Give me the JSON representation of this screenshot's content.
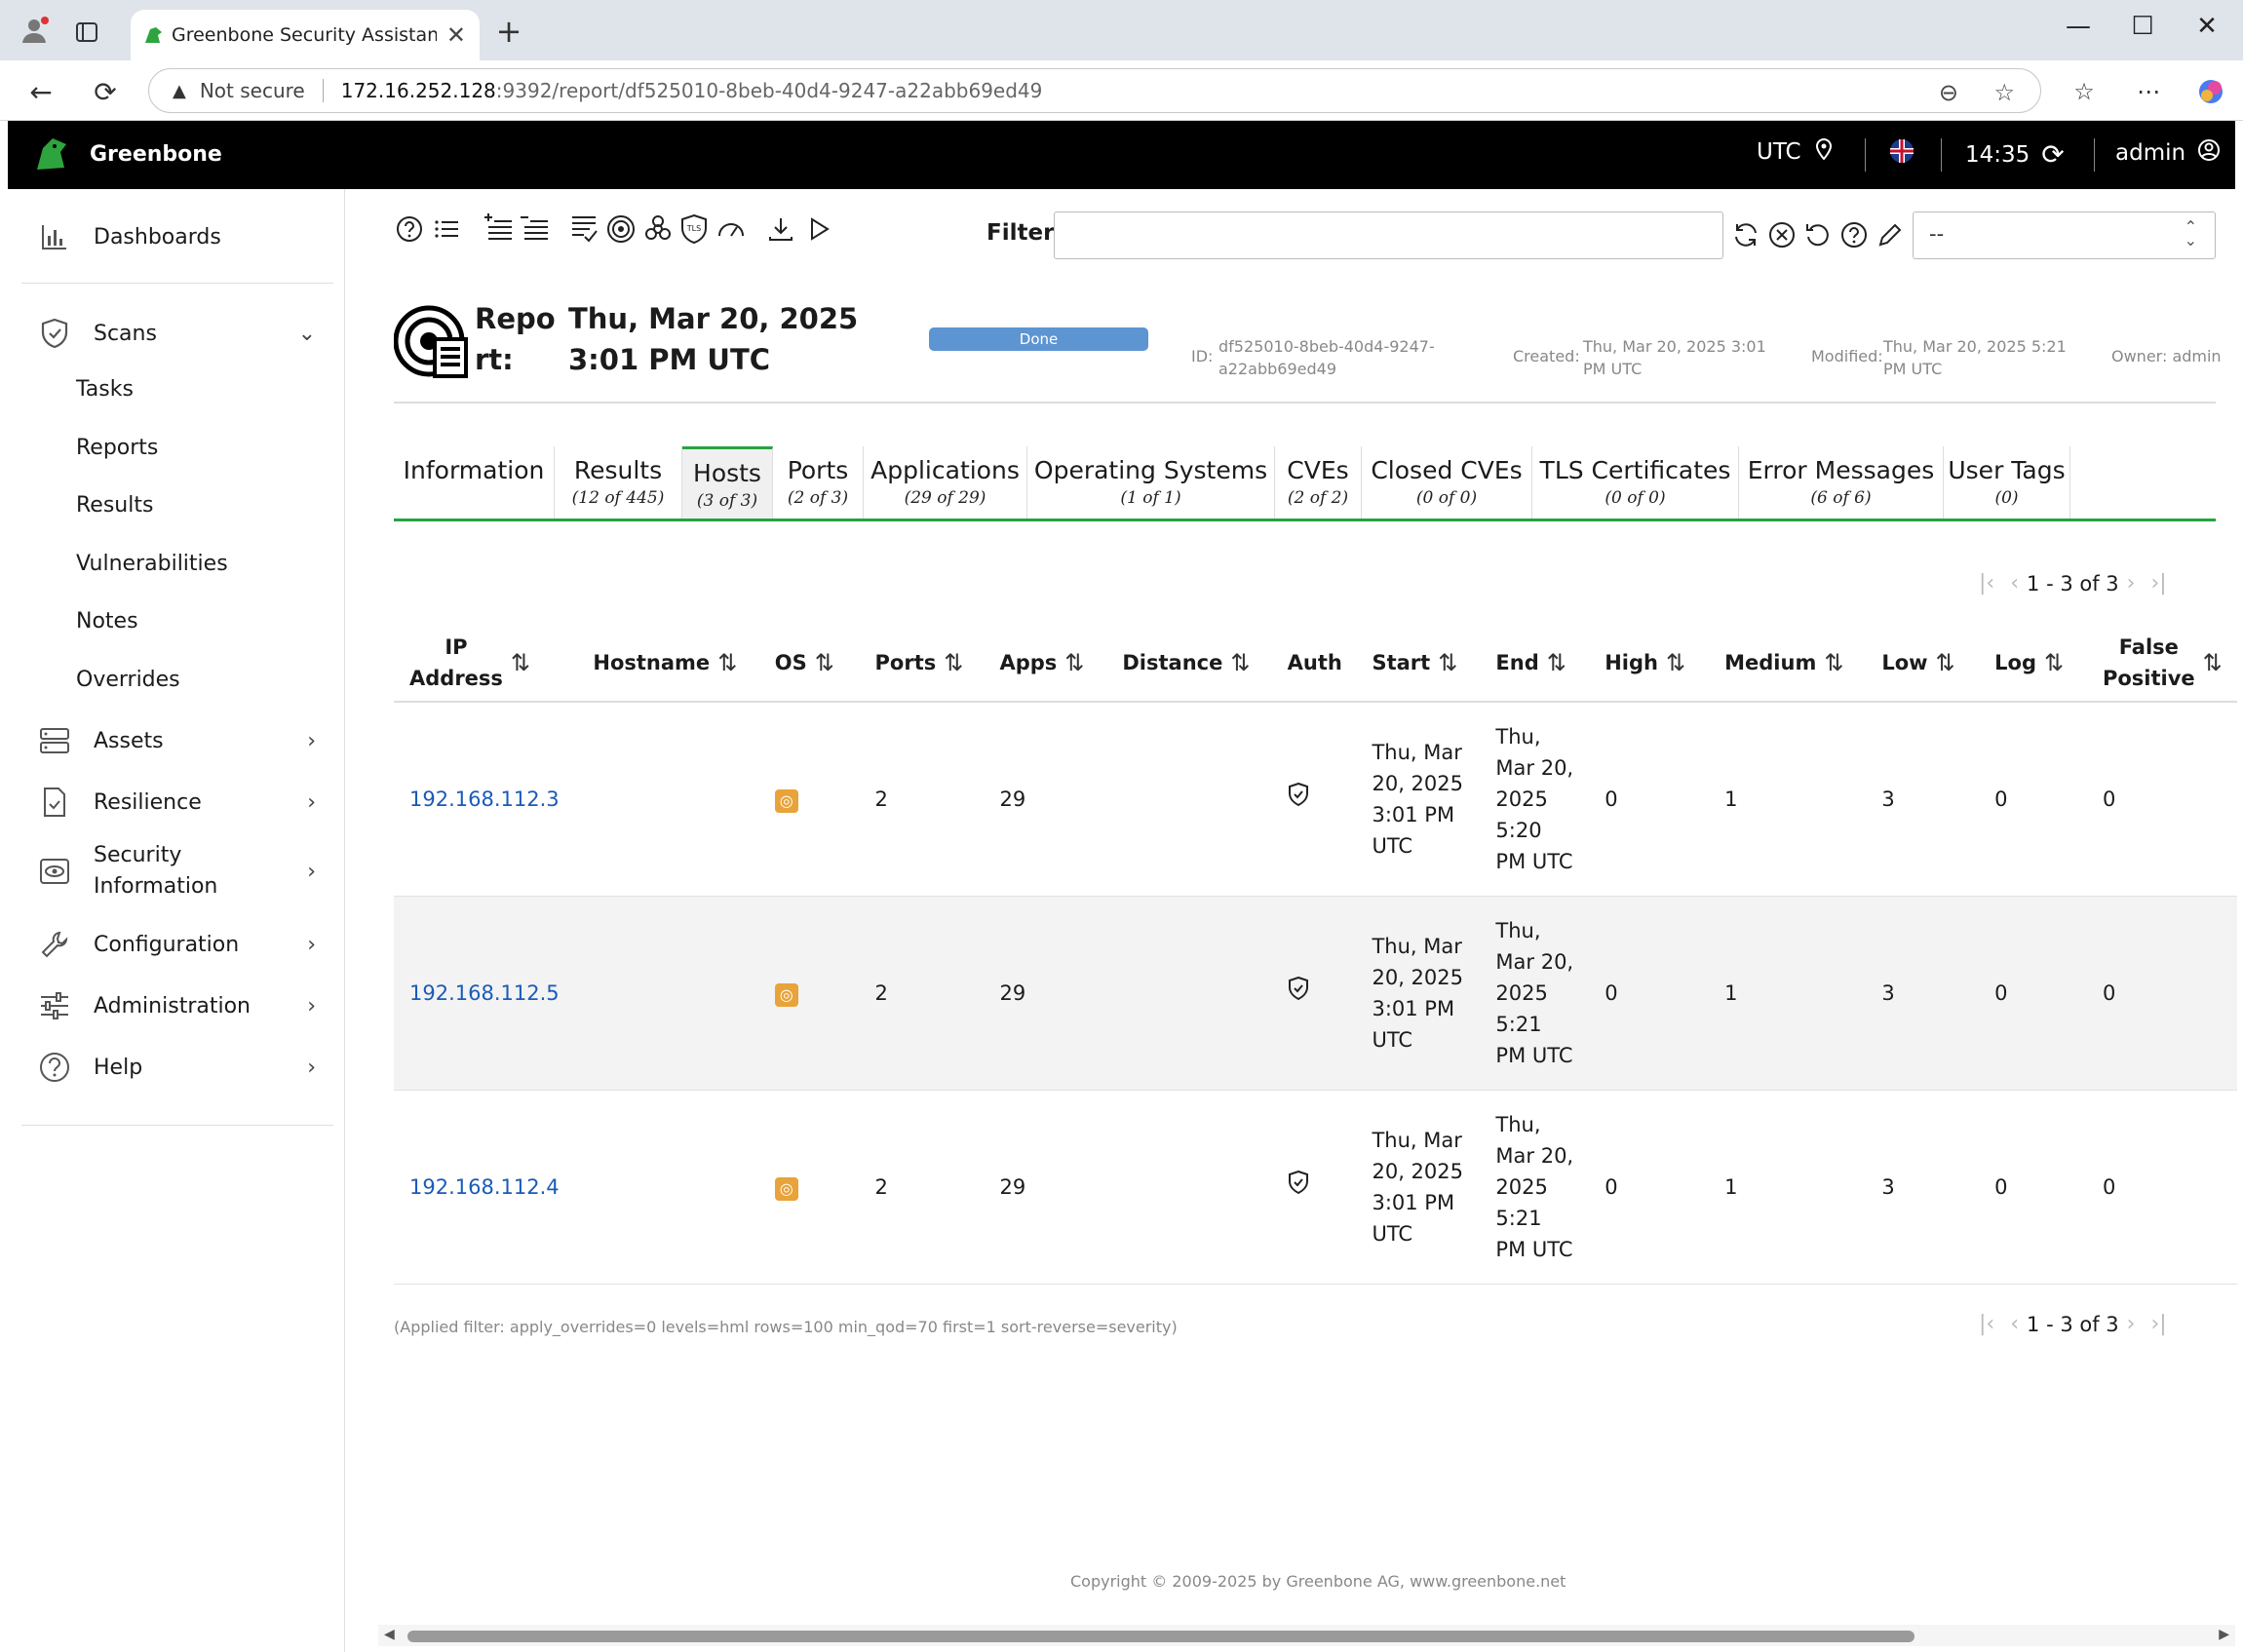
{
  "browser": {
    "tab_title": "Greenbone Security Assistant - Re",
    "tab_close": "✕",
    "new_tab": "+",
    "window": {
      "minimize": "—",
      "maximize": "☐",
      "close": "✕"
    },
    "security_label": "Not secure",
    "url_host": "172.16.252.128",
    "url_path": ":9392/report/df525010-8beb-40d4-9247-a22abb69ed49"
  },
  "header": {
    "brand": "Greenbone",
    "timezone": "UTC",
    "time": "14:35",
    "user": "admin"
  },
  "sidebar": {
    "dashboards": "Dashboards",
    "scans": "Scans",
    "scans_items": [
      "Tasks",
      "Reports",
      "Results",
      "Vulnerabilities",
      "Notes",
      "Overrides"
    ],
    "assets": "Assets",
    "resilience": "Resilience",
    "security_information_1": "Security",
    "security_information_2": "Information",
    "configuration": "Configuration",
    "administration": "Administration",
    "help": "Help"
  },
  "filter": {
    "label": "Filter",
    "value": "",
    "select_value": "--"
  },
  "report": {
    "title_prefix": "Report:",
    "title_date": "Thu, Mar 20, 2025 3:01 PM UTC",
    "status": "Done",
    "id_label": "ID:",
    "id_value": "df525010-8beb-40d4-9247-a22abb69ed49",
    "created_label": "Created:",
    "created_value": "Thu, Mar 20, 2025 3:01 PM UTC",
    "modified_label": "Modified:",
    "modified_value": "Thu, Mar 20, 2025 5:21 PM UTC",
    "owner": "Owner: admin"
  },
  "tabs": [
    {
      "label": "Information",
      "count": ""
    },
    {
      "label": "Results",
      "count": "(12 of 445)"
    },
    {
      "label": "Hosts",
      "count": "(3 of 3)"
    },
    {
      "label": "Ports",
      "count": "(2 of 3)"
    },
    {
      "label": "Applications",
      "count": "(29 of 29)"
    },
    {
      "label": "Operating Systems",
      "count": "(1 of 1)"
    },
    {
      "label": "CVEs",
      "count": "(2 of 2)"
    },
    {
      "label": "Closed CVEs",
      "count": "(0 of 0)"
    },
    {
      "label": "TLS Certificates",
      "count": "(0 of 0)"
    },
    {
      "label": "Error Messages",
      "count": "(6 of 6)"
    },
    {
      "label": "User Tags",
      "count": "(0)"
    }
  ],
  "pager": "1 - 3 of 3",
  "table": {
    "headers": {
      "ip_1": "IP",
      "ip_2": "Address",
      "hostname": "Hostname",
      "os": "OS",
      "ports": "Ports",
      "apps": "Apps",
      "distance": "Distance",
      "auth": "Auth",
      "start": "Start",
      "end": "End",
      "high": "High",
      "medium": "Medium",
      "low": "Low",
      "log": "Log",
      "fp_1": "False",
      "fp_2": "Positive"
    },
    "rows": [
      {
        "ip": "192.168.112.3",
        "hostname": "",
        "ports": "2",
        "apps": "29",
        "distance": "",
        "start": [
          "Thu, Mar",
          "20, 2025",
          "3:01 PM",
          "UTC"
        ],
        "end": [
          "Thu,",
          "Mar 20,",
          "2025",
          "5:20",
          "PM UTC"
        ],
        "high": "0",
        "medium": "1",
        "low": "3",
        "log": "0",
        "false_positive": "0"
      },
      {
        "ip": "192.168.112.5",
        "hostname": "",
        "ports": "2",
        "apps": "29",
        "distance": "",
        "start": [
          "Thu, Mar",
          "20, 2025",
          "3:01 PM",
          "UTC"
        ],
        "end": [
          "Thu,",
          "Mar 20,",
          "2025",
          "5:21",
          "PM UTC"
        ],
        "high": "0",
        "medium": "1",
        "low": "3",
        "log": "0",
        "false_positive": "0"
      },
      {
        "ip": "192.168.112.4",
        "hostname": "",
        "ports": "2",
        "apps": "29",
        "distance": "",
        "start": [
          "Thu, Mar",
          "20, 2025",
          "3:01 PM",
          "UTC"
        ],
        "end": [
          "Thu,",
          "Mar 20,",
          "2025",
          "5:21",
          "PM UTC"
        ],
        "high": "0",
        "medium": "1",
        "low": "3",
        "log": "0",
        "false_positive": "0"
      }
    ]
  },
  "applied_filter": "(Applied filter: apply_overrides=0 levels=hml rows=100 min_qod=70 first=1 sort-reverse=severity)",
  "copyright": "Copyright © 2009-2025 by Greenbone AG, www.greenbone.net",
  "icons": {
    "os": "ubuntu-icon",
    "auth": "shield-check-icon",
    "sort": "sort-arrows-icon"
  },
  "colors": {
    "accent_green": "#25a341",
    "status_done": "#5d94d2",
    "link": "#1a5bb8"
  }
}
